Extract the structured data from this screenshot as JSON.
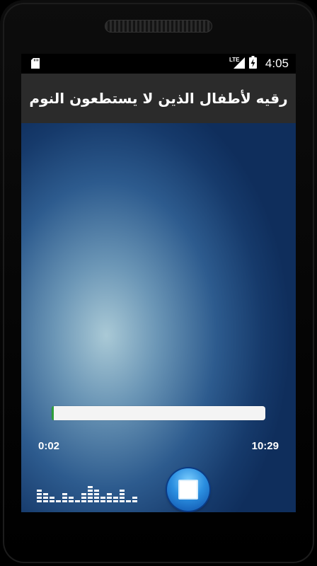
{
  "status_bar": {
    "time": "4:05",
    "network": "LTE",
    "icons": [
      "sd-card-icon",
      "lte-signal-icon",
      "battery-charging-icon"
    ]
  },
  "header": {
    "title": "رقيه لأطفال الذين لا يستطعون النوم"
  },
  "player": {
    "elapsed": "0:02",
    "duration": "10:29",
    "progress_fraction": 0.003,
    "stop_icon": "stop-icon",
    "equalizer_levels": [
      4,
      3,
      2,
      1,
      3,
      2,
      1,
      3,
      5,
      4,
      2,
      3,
      2,
      4,
      1,
      2
    ]
  },
  "colors": {
    "title_bar": "#2b2b2b",
    "progress_fill": "#2e9e3a",
    "stop_button": "#2b8fe0"
  }
}
